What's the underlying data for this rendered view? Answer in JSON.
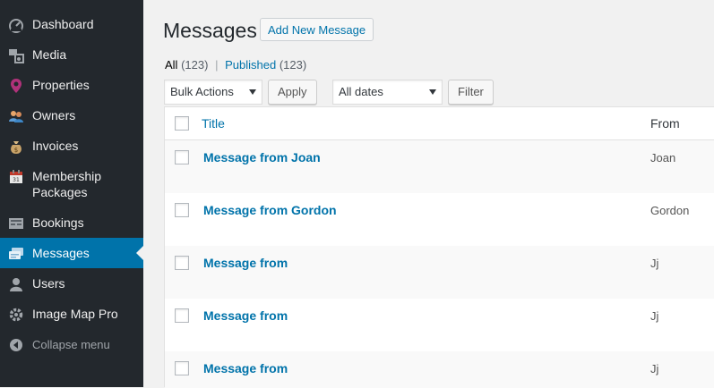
{
  "sidebar": {
    "items": [
      {
        "label": "Dashboard",
        "icon": "dashboard-icon"
      },
      {
        "label": "Media",
        "icon": "media-icon"
      },
      {
        "label": "Properties",
        "icon": "location-pin-icon"
      },
      {
        "label": "Owners",
        "icon": "owners-icon"
      },
      {
        "label": "Invoices",
        "icon": "invoice-icon"
      },
      {
        "label": "Membership Packages",
        "icon": "calendar-icon"
      },
      {
        "label": "Bookings",
        "icon": "bookings-icon"
      },
      {
        "label": "Messages",
        "icon": "messages-icon",
        "active": true
      },
      {
        "label": "Users",
        "icon": "user-icon"
      },
      {
        "label": "Image Map Pro",
        "icon": "gear-icon"
      }
    ],
    "collapse_label": "Collapse menu"
  },
  "header": {
    "title": "Messages",
    "add_new_label": "Add New Message"
  },
  "filters": {
    "all_label": "All",
    "all_count": "(123)",
    "separator": "|",
    "published_label": "Published",
    "published_count": "(123)"
  },
  "toolbar": {
    "bulk_actions": "Bulk Actions",
    "apply_label": "Apply",
    "dates": "All dates",
    "filter_label": "Filter"
  },
  "table": {
    "columns": [
      "Title",
      "From"
    ],
    "rows": [
      {
        "title": "Message from Joan",
        "from": "Joan"
      },
      {
        "title": "Message from Gordon",
        "from": "Gordon"
      },
      {
        "title": "Message from",
        "from": "Jj"
      },
      {
        "title": "Message from",
        "from": "Jj"
      },
      {
        "title": "Message from",
        "from": "Jj"
      }
    ]
  },
  "colors": {
    "sidebar_bg": "#23282d",
    "accent": "#0073aa",
    "page_bg": "#f1f1f1"
  }
}
